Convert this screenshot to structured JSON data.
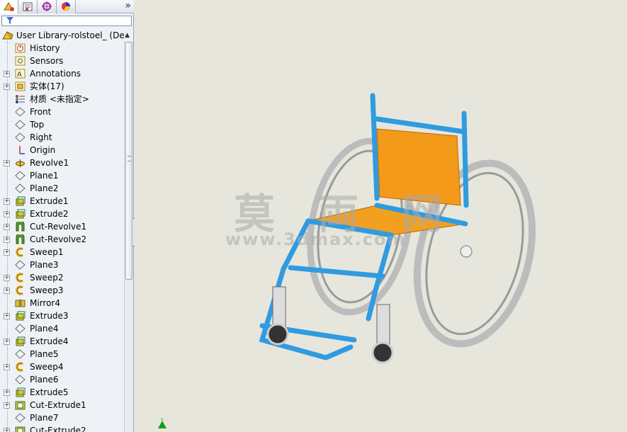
{
  "tabs": [
    {
      "name": "feature-manager-icon"
    },
    {
      "name": "property-manager-icon"
    },
    {
      "name": "configuration-manager-icon"
    },
    {
      "name": "display-manager-icon"
    }
  ],
  "tabbar": {
    "more": "»"
  },
  "root": {
    "label": "User Library-rolstoel_  (De"
  },
  "tree": [
    {
      "label": "History",
      "icon": "history-icon",
      "exp": false
    },
    {
      "label": "Sensors",
      "icon": "sensors-icon",
      "exp": false
    },
    {
      "label": "Annotations",
      "icon": "annotations-icon",
      "exp": true
    },
    {
      "label": "实体(17)",
      "icon": "solid-bodies-icon",
      "exp": true
    },
    {
      "label": "材质 <未指定>",
      "icon": "material-icon",
      "exp": false
    },
    {
      "label": "Front",
      "icon": "plane-icon",
      "exp": false
    },
    {
      "label": "Top",
      "icon": "plane-icon",
      "exp": false
    },
    {
      "label": "Right",
      "icon": "plane-icon",
      "exp": false
    },
    {
      "label": "Origin",
      "icon": "origin-icon",
      "exp": false
    },
    {
      "label": "Revolve1",
      "icon": "revolve-icon",
      "exp": true
    },
    {
      "label": "Plane1",
      "icon": "plane-icon",
      "exp": false
    },
    {
      "label": "Plane2",
      "icon": "plane-icon",
      "exp": false
    },
    {
      "label": "Extrude1",
      "icon": "extrude-icon",
      "exp": true
    },
    {
      "label": "Extrude2",
      "icon": "extrude-icon",
      "exp": true
    },
    {
      "label": "Cut-Revolve1",
      "icon": "cut-revolve-icon",
      "exp": true
    },
    {
      "label": "Cut-Revolve2",
      "icon": "cut-revolve-icon",
      "exp": true
    },
    {
      "label": "Sweep1",
      "icon": "sweep-icon",
      "exp": true
    },
    {
      "label": "Plane3",
      "icon": "plane-icon",
      "exp": false
    },
    {
      "label": "Sweep2",
      "icon": "sweep-icon",
      "exp": true
    },
    {
      "label": "Sweep3",
      "icon": "sweep-icon",
      "exp": true
    },
    {
      "label": "Mirror4",
      "icon": "mirror-icon",
      "exp": false
    },
    {
      "label": "Extrude3",
      "icon": "extrude-icon",
      "exp": true
    },
    {
      "label": "Plane4",
      "icon": "plane-icon",
      "exp": false
    },
    {
      "label": "Extrude4",
      "icon": "extrude-icon",
      "exp": true
    },
    {
      "label": "Plane5",
      "icon": "plane-icon",
      "exp": false
    },
    {
      "label": "Sweep4",
      "icon": "sweep-icon",
      "exp": true
    },
    {
      "label": "Plane6",
      "icon": "plane-icon",
      "exp": false
    },
    {
      "label": "Extrude5",
      "icon": "extrude-icon",
      "exp": true
    },
    {
      "label": "Cut-Extrude1",
      "icon": "cut-extrude-icon",
      "exp": true
    },
    {
      "label": "Plane7",
      "icon": "plane-icon",
      "exp": false
    },
    {
      "label": "Cut-Extrude2",
      "icon": "cut-extrude-icon",
      "exp": true
    }
  ],
  "viewport": {
    "watermark_cn": "莫 両 网",
    "watermark_en": "www.3dmax.com",
    "triad_label": "Y"
  },
  "colors": {
    "frame_blue": "#2f9be0",
    "seat_orange": "#f3a020",
    "wheel_gray": "#c8c8c8",
    "background": "#e6e6dc"
  }
}
